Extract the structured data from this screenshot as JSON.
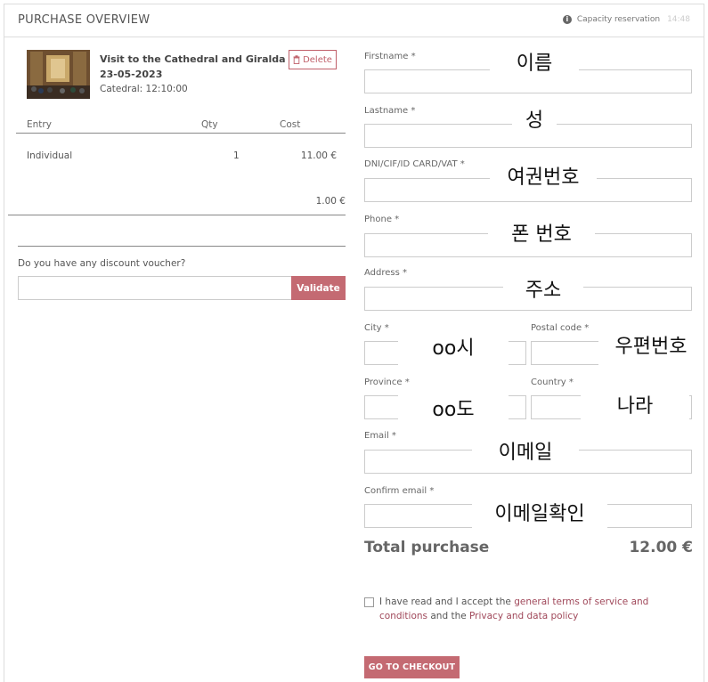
{
  "header": {
    "title": "PURCHASE OVERVIEW",
    "capacity_label": "Capacity reservation",
    "timer": "14:48"
  },
  "event": {
    "title": "Visit to the Cathedral and Giralda",
    "date": "23-05-2023",
    "place_time": "Catedral: 12:10:00",
    "delete_label": "Delete"
  },
  "table": {
    "headers": [
      "Entry",
      "Qty",
      "Cost"
    ],
    "rows": [
      {
        "entry": "Individual",
        "qty": "1",
        "cost": "11.00 €"
      }
    ],
    "fee": "1.00 €"
  },
  "voucher": {
    "label": "Do you have any discount voucher?",
    "placeholder": "",
    "validate_label": "Validate"
  },
  "form": {
    "firstname": {
      "label": "Firstname *",
      "overlay": "이름"
    },
    "lastname": {
      "label": "Lastname *",
      "overlay": "성"
    },
    "dni": {
      "label": "DNI/CIF/ID CARD/VAT *",
      "overlay": "여권번호"
    },
    "phone": {
      "label": "Phone *",
      "overlay": "폰 번호"
    },
    "address": {
      "label": "Address *",
      "overlay": "주소"
    },
    "city": {
      "label": "City *",
      "overlay": "oo시"
    },
    "postal": {
      "label": "Postal code *",
      "overlay": "우편번호"
    },
    "province": {
      "label": "Province *",
      "overlay": "oo도"
    },
    "country": {
      "label": "Country *",
      "overlay": "나라"
    },
    "email": {
      "label": "Email *",
      "overlay": "이메일"
    },
    "confirm_email": {
      "label": "Confirm email *",
      "overlay": "이메일확인"
    }
  },
  "total": {
    "label": "Total purchase",
    "value": "12.00 €"
  },
  "terms": {
    "prefix": "I have read and I accept the ",
    "link1": "general terms of service and conditions",
    "middle": " and the ",
    "link2": "Privacy and data policy"
  },
  "checkout_label": "GO TO CHECKOUT",
  "colors": {
    "accent": "#c46a72",
    "link": "#a0485a"
  }
}
